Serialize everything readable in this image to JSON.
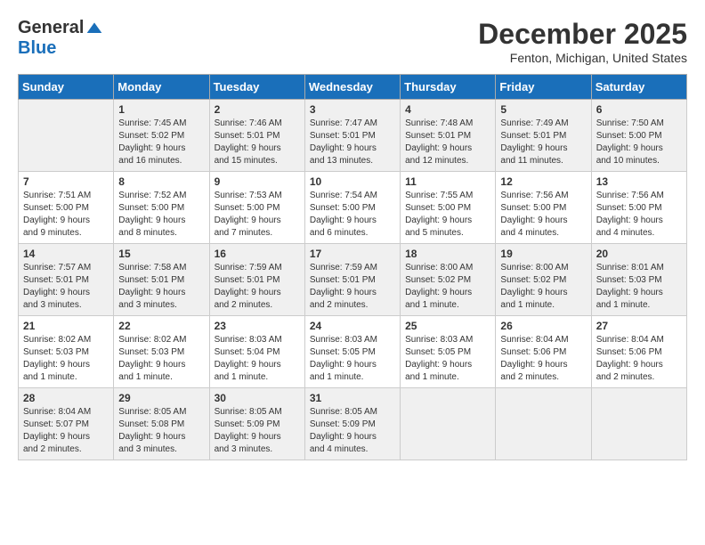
{
  "logo": {
    "general": "General",
    "blue": "Blue"
  },
  "title": "December 2025",
  "location": "Fenton, Michigan, United States",
  "days_header": [
    "Sunday",
    "Monday",
    "Tuesday",
    "Wednesday",
    "Thursday",
    "Friday",
    "Saturday"
  ],
  "weeks": [
    [
      {
        "num": "",
        "info": ""
      },
      {
        "num": "1",
        "info": "Sunrise: 7:45 AM\nSunset: 5:02 PM\nDaylight: 9 hours\nand 16 minutes."
      },
      {
        "num": "2",
        "info": "Sunrise: 7:46 AM\nSunset: 5:01 PM\nDaylight: 9 hours\nand 15 minutes."
      },
      {
        "num": "3",
        "info": "Sunrise: 7:47 AM\nSunset: 5:01 PM\nDaylight: 9 hours\nand 13 minutes."
      },
      {
        "num": "4",
        "info": "Sunrise: 7:48 AM\nSunset: 5:01 PM\nDaylight: 9 hours\nand 12 minutes."
      },
      {
        "num": "5",
        "info": "Sunrise: 7:49 AM\nSunset: 5:01 PM\nDaylight: 9 hours\nand 11 minutes."
      },
      {
        "num": "6",
        "info": "Sunrise: 7:50 AM\nSunset: 5:00 PM\nDaylight: 9 hours\nand 10 minutes."
      }
    ],
    [
      {
        "num": "7",
        "info": "Sunrise: 7:51 AM\nSunset: 5:00 PM\nDaylight: 9 hours\nand 9 minutes."
      },
      {
        "num": "8",
        "info": "Sunrise: 7:52 AM\nSunset: 5:00 PM\nDaylight: 9 hours\nand 8 minutes."
      },
      {
        "num": "9",
        "info": "Sunrise: 7:53 AM\nSunset: 5:00 PM\nDaylight: 9 hours\nand 7 minutes."
      },
      {
        "num": "10",
        "info": "Sunrise: 7:54 AM\nSunset: 5:00 PM\nDaylight: 9 hours\nand 6 minutes."
      },
      {
        "num": "11",
        "info": "Sunrise: 7:55 AM\nSunset: 5:00 PM\nDaylight: 9 hours\nand 5 minutes."
      },
      {
        "num": "12",
        "info": "Sunrise: 7:56 AM\nSunset: 5:00 PM\nDaylight: 9 hours\nand 4 minutes."
      },
      {
        "num": "13",
        "info": "Sunrise: 7:56 AM\nSunset: 5:00 PM\nDaylight: 9 hours\nand 4 minutes."
      }
    ],
    [
      {
        "num": "14",
        "info": "Sunrise: 7:57 AM\nSunset: 5:01 PM\nDaylight: 9 hours\nand 3 minutes."
      },
      {
        "num": "15",
        "info": "Sunrise: 7:58 AM\nSunset: 5:01 PM\nDaylight: 9 hours\nand 3 minutes."
      },
      {
        "num": "16",
        "info": "Sunrise: 7:59 AM\nSunset: 5:01 PM\nDaylight: 9 hours\nand 2 minutes."
      },
      {
        "num": "17",
        "info": "Sunrise: 7:59 AM\nSunset: 5:01 PM\nDaylight: 9 hours\nand 2 minutes."
      },
      {
        "num": "18",
        "info": "Sunrise: 8:00 AM\nSunset: 5:02 PM\nDaylight: 9 hours\nand 1 minute."
      },
      {
        "num": "19",
        "info": "Sunrise: 8:00 AM\nSunset: 5:02 PM\nDaylight: 9 hours\nand 1 minute."
      },
      {
        "num": "20",
        "info": "Sunrise: 8:01 AM\nSunset: 5:03 PM\nDaylight: 9 hours\nand 1 minute."
      }
    ],
    [
      {
        "num": "21",
        "info": "Sunrise: 8:02 AM\nSunset: 5:03 PM\nDaylight: 9 hours\nand 1 minute."
      },
      {
        "num": "22",
        "info": "Sunrise: 8:02 AM\nSunset: 5:03 PM\nDaylight: 9 hours\nand 1 minute."
      },
      {
        "num": "23",
        "info": "Sunrise: 8:03 AM\nSunset: 5:04 PM\nDaylight: 9 hours\nand 1 minute."
      },
      {
        "num": "24",
        "info": "Sunrise: 8:03 AM\nSunset: 5:05 PM\nDaylight: 9 hours\nand 1 minute."
      },
      {
        "num": "25",
        "info": "Sunrise: 8:03 AM\nSunset: 5:05 PM\nDaylight: 9 hours\nand 1 minute."
      },
      {
        "num": "26",
        "info": "Sunrise: 8:04 AM\nSunset: 5:06 PM\nDaylight: 9 hours\nand 2 minutes."
      },
      {
        "num": "27",
        "info": "Sunrise: 8:04 AM\nSunset: 5:06 PM\nDaylight: 9 hours\nand 2 minutes."
      }
    ],
    [
      {
        "num": "28",
        "info": "Sunrise: 8:04 AM\nSunset: 5:07 PM\nDaylight: 9 hours\nand 2 minutes."
      },
      {
        "num": "29",
        "info": "Sunrise: 8:05 AM\nSunset: 5:08 PM\nDaylight: 9 hours\nand 3 minutes."
      },
      {
        "num": "30",
        "info": "Sunrise: 8:05 AM\nSunset: 5:09 PM\nDaylight: 9 hours\nand 3 minutes."
      },
      {
        "num": "31",
        "info": "Sunrise: 8:05 AM\nSunset: 5:09 PM\nDaylight: 9 hours\nand 4 minutes."
      },
      {
        "num": "",
        "info": ""
      },
      {
        "num": "",
        "info": ""
      },
      {
        "num": "",
        "info": ""
      }
    ]
  ]
}
